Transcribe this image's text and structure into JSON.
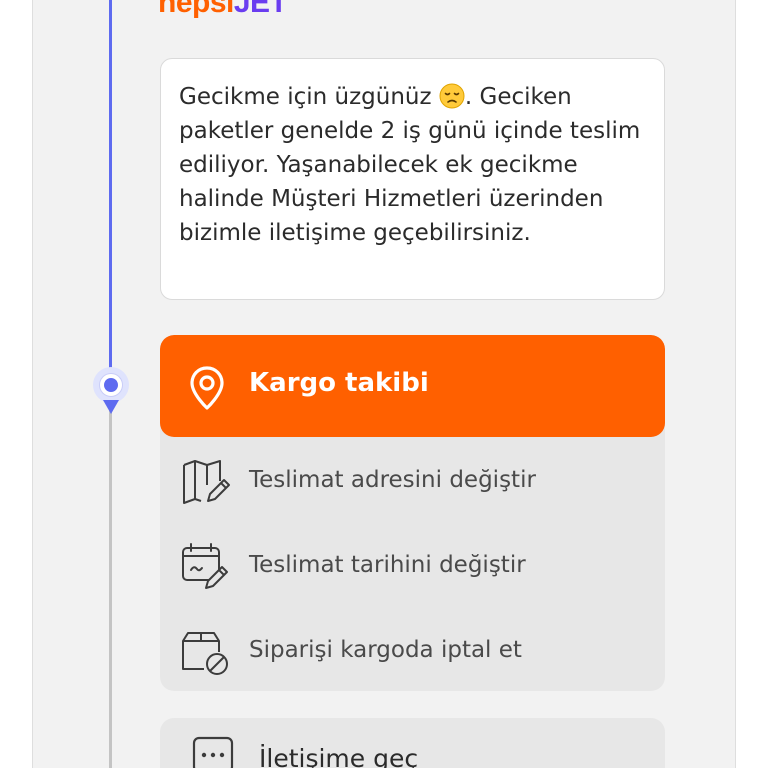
{
  "brand": {
    "part1": "hepsi",
    "part2": "JET",
    "color_primary": "#ff6000",
    "color_secondary": "#6a3df0"
  },
  "message": {
    "text_before_emoji": "Gecikme için üzgünüz ",
    "emoji_icon": "disappointed-face-icon",
    "text_after_emoji": ". Geciken paketler genelde 2 iş günü içinde teslim ediliyor. Yaşanabilecek ek gecikme halinde Müşteri Hizmetleri üzerinden bizimle iletişime geçebilirsiniz."
  },
  "tracking": {
    "title": "Kargo takibi",
    "title_icon": "location-pin-icon",
    "accent": "#ff6000",
    "options": [
      {
        "label": "Teslimat adresini değiştir",
        "icon": "map-edit-icon"
      },
      {
        "label": "Teslimat tarihini değiştir",
        "icon": "calendar-edit-icon"
      },
      {
        "label": "Siparişi kargoda iptal et",
        "icon": "package-cancel-icon"
      }
    ]
  },
  "contact": {
    "label": "İletişime geç",
    "icon": "chat-bubble-icon"
  },
  "timeline": {
    "active_color": "#5e6bf0",
    "inactive_color": "#c4c4c4"
  }
}
